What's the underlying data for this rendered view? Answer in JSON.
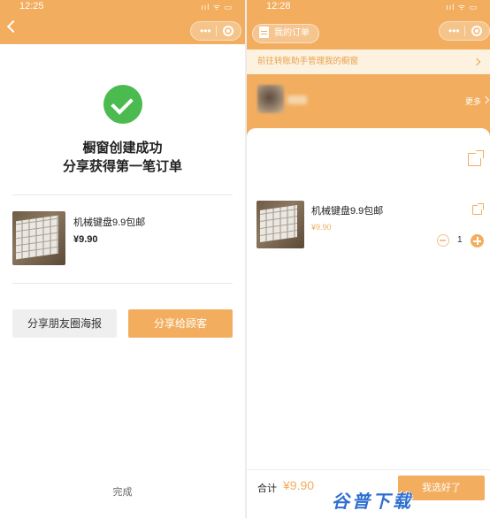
{
  "left": {
    "status_time": "12:25",
    "status_icons": "ııl ᯤ ▭",
    "title_line1": "橱窗创建成功",
    "title_line2": "分享获得第一笔订单",
    "product": {
      "name": "机械键盘9.9包邮",
      "price": "¥9.90"
    },
    "buttons": {
      "poster": "分享朋友圈海报",
      "share": "分享给顾客"
    },
    "done": "完成"
  },
  "right": {
    "status_time": "12:28",
    "status_icons": "ııl ᯤ ▭",
    "order_button": "我的订单",
    "notice": "前往转账助手管理我的橱窗",
    "more": "更多",
    "product": {
      "name": "机械键盘9.9包邮",
      "price": "¥9.90",
      "quantity": "1"
    },
    "total_label": "合计",
    "total_value": "¥9.90",
    "pay_button": "我选好了",
    "watermark": "谷普下载"
  },
  "colors": {
    "accent": "#f2ad5f",
    "success": "#4cbb4f",
    "notice_bg": "#fdf1df"
  },
  "icons": [
    "back-arrow-icon",
    "more-dots-icon",
    "close-target-icon",
    "check-icon",
    "document-icon",
    "chevron-right-icon",
    "share-icon",
    "minus-icon",
    "plus-icon"
  ]
}
